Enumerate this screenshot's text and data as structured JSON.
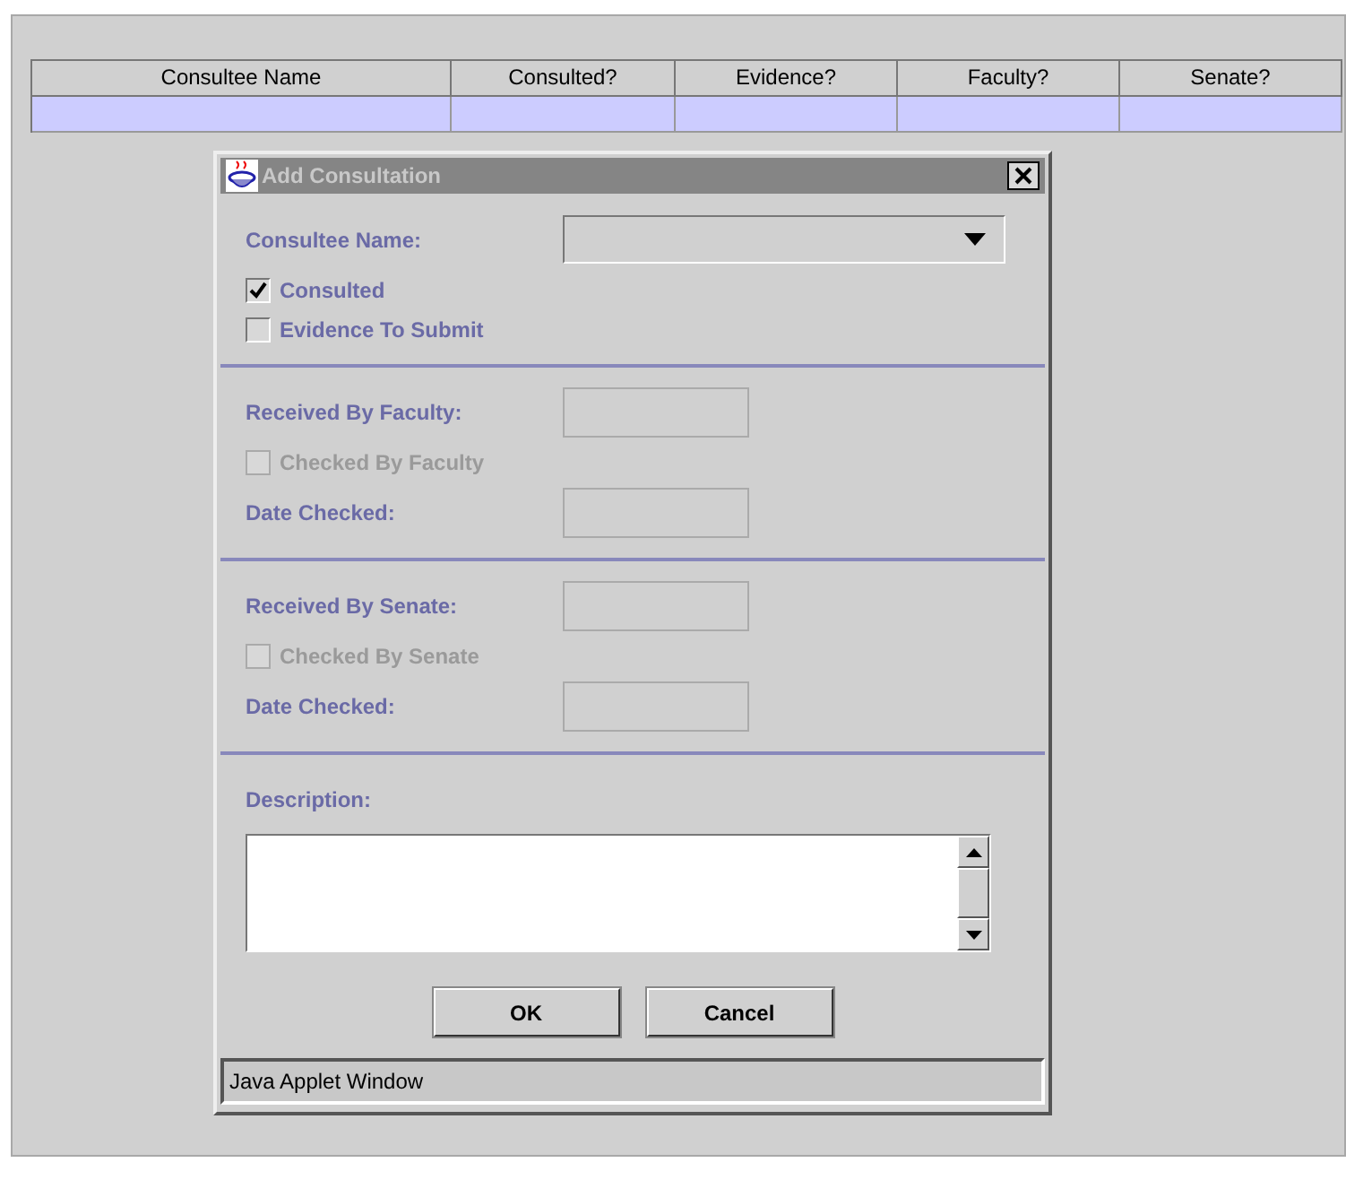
{
  "table": {
    "columns": [
      "Consultee Name",
      "Consulted?",
      "Evidence?",
      "Faculty?",
      "Senate?"
    ],
    "rows": [
      {
        "selected": true
      }
    ]
  },
  "dialog": {
    "title": "Add Consultation",
    "sections": [
      {
        "items": [
          {
            "kind": "combo",
            "label": "Consultee Name:"
          },
          {
            "kind": "checkbox",
            "label": "Consulted",
            "checked": true,
            "disabled": false
          },
          {
            "kind": "checkbox",
            "label": "Evidence To Submit",
            "checked": false,
            "disabled": false
          }
        ]
      },
      {
        "items": [
          {
            "kind": "text",
            "label": "Received By Faculty:"
          },
          {
            "kind": "checkbox",
            "label": "Checked By Faculty",
            "checked": false,
            "disabled": true
          },
          {
            "kind": "text",
            "label": "Date Checked:"
          }
        ]
      },
      {
        "items": [
          {
            "kind": "text",
            "label": "Received By Senate:"
          },
          {
            "kind": "checkbox",
            "label": "Checked By Senate",
            "checked": false,
            "disabled": true
          },
          {
            "kind": "text",
            "label": "Date Checked:"
          }
        ]
      },
      {
        "items": [
          {
            "kind": "textarea",
            "label": "Description:"
          }
        ]
      }
    ],
    "buttons": [
      "OK",
      "Cancel"
    ],
    "status": "Java Applet Window"
  }
}
